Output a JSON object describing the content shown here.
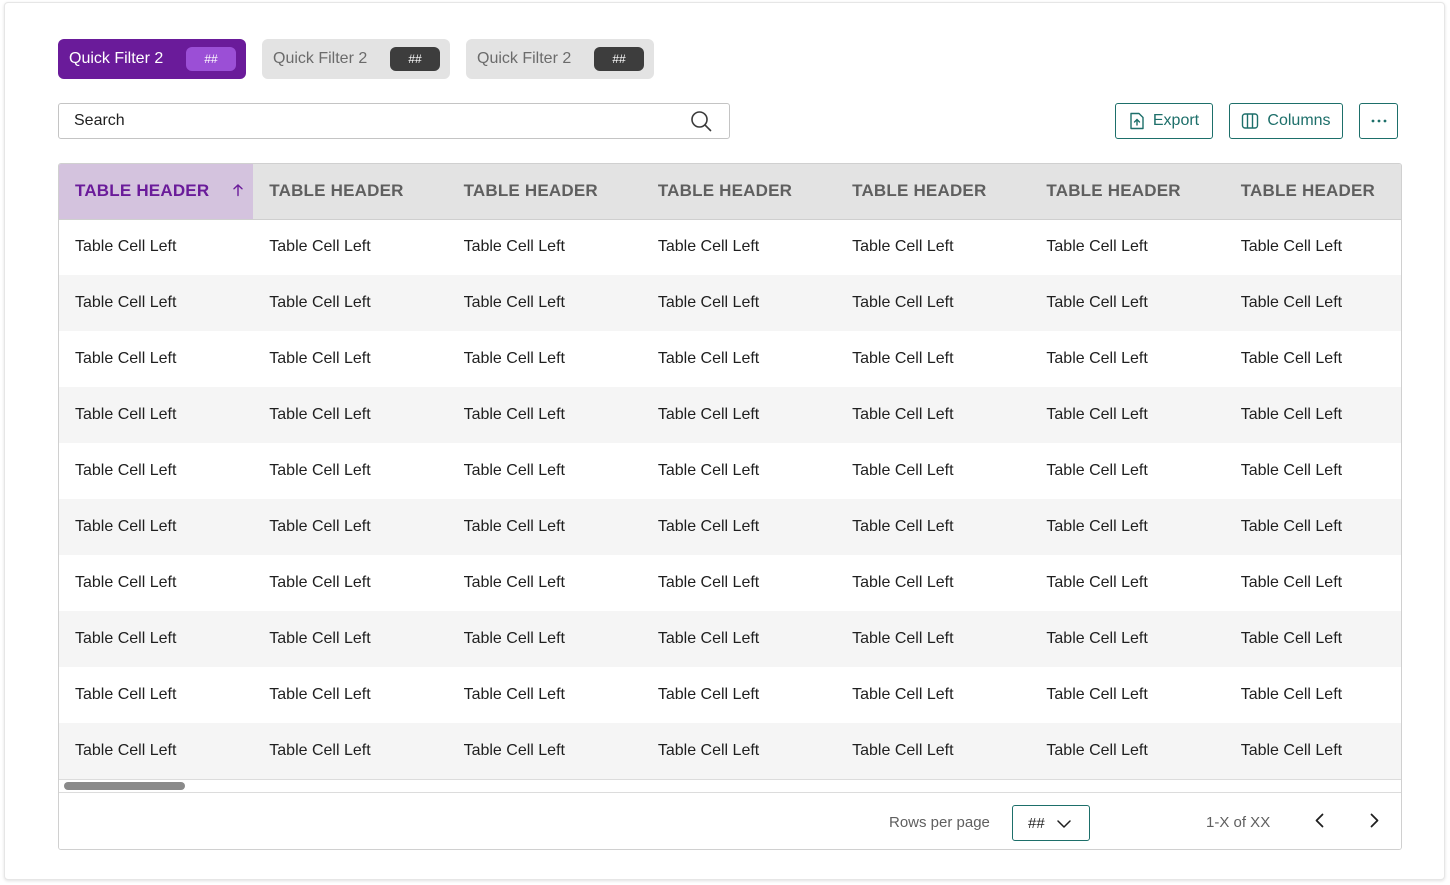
{
  "filters": [
    {
      "label": "Quick Filter 2",
      "badge": "##",
      "state": "active"
    },
    {
      "label": "Quick Filter 2",
      "badge": "##",
      "state": "inactive"
    },
    {
      "label": "Quick Filter 2",
      "badge": "##",
      "state": "inactive"
    }
  ],
  "search": {
    "placeholder": "Search",
    "icon": "search-icon"
  },
  "toolbar": {
    "export_label": "Export",
    "export_icon": "file-upload-icon",
    "columns_label": "Columns",
    "columns_icon": "columns-icon",
    "more_icon": "more-horizontal-icon"
  },
  "table": {
    "headers": [
      "TABLE HEADER",
      "TABLE HEADER",
      "TABLE HEADER",
      "TABLE HEADER",
      "TABLE HEADER",
      "TABLE HEADER",
      "TABLE HEADER"
    ],
    "sorted_column": 0,
    "sort_direction": "ascending",
    "rows": [
      [
        "Table Cell Left",
        "Table Cell Left",
        "Table Cell Left",
        "Table Cell Left",
        "Table Cell Left",
        "Table Cell Left",
        "Table Cell Left"
      ],
      [
        "Table Cell Left",
        "Table Cell Left",
        "Table Cell Left",
        "Table Cell Left",
        "Table Cell Left",
        "Table Cell Left",
        "Table Cell Left"
      ],
      [
        "Table Cell Left",
        "Table Cell Left",
        "Table Cell Left",
        "Table Cell Left",
        "Table Cell Left",
        "Table Cell Left",
        "Table Cell Left"
      ],
      [
        "Table Cell Left",
        "Table Cell Left",
        "Table Cell Left",
        "Table Cell Left",
        "Table Cell Left",
        "Table Cell Left",
        "Table Cell Left"
      ],
      [
        "Table Cell Left",
        "Table Cell Left",
        "Table Cell Left",
        "Table Cell Left",
        "Table Cell Left",
        "Table Cell Left",
        "Table Cell Left"
      ],
      [
        "Table Cell Left",
        "Table Cell Left",
        "Table Cell Left",
        "Table Cell Left",
        "Table Cell Left",
        "Table Cell Left",
        "Table Cell Left"
      ],
      [
        "Table Cell Left",
        "Table Cell Left",
        "Table Cell Left",
        "Table Cell Left",
        "Table Cell Left",
        "Table Cell Left",
        "Table Cell Left"
      ],
      [
        "Table Cell Left",
        "Table Cell Left",
        "Table Cell Left",
        "Table Cell Left",
        "Table Cell Left",
        "Table Cell Left",
        "Table Cell Left"
      ],
      [
        "Table Cell Left",
        "Table Cell Left",
        "Table Cell Left",
        "Table Cell Left",
        "Table Cell Left",
        "Table Cell Left",
        "Table Cell Left"
      ],
      [
        "Table Cell Left",
        "Table Cell Left",
        "Table Cell Left",
        "Table Cell Left",
        "Table Cell Left",
        "Table Cell Left",
        "Table Cell Left"
      ]
    ]
  },
  "pagination": {
    "rows_per_page_label": "Rows per page",
    "rows_per_page_value": "##",
    "range_text": "1-X of XX"
  },
  "colors": {
    "primary_purple": "#6a1b9a",
    "badge_purple": "#9b4fd6",
    "sorted_header_bg": "#d4c3de",
    "teal_accent": "#1d6f6a",
    "header_bg": "#e3e3e3",
    "striped_row_bg": "#f5f5f5"
  }
}
